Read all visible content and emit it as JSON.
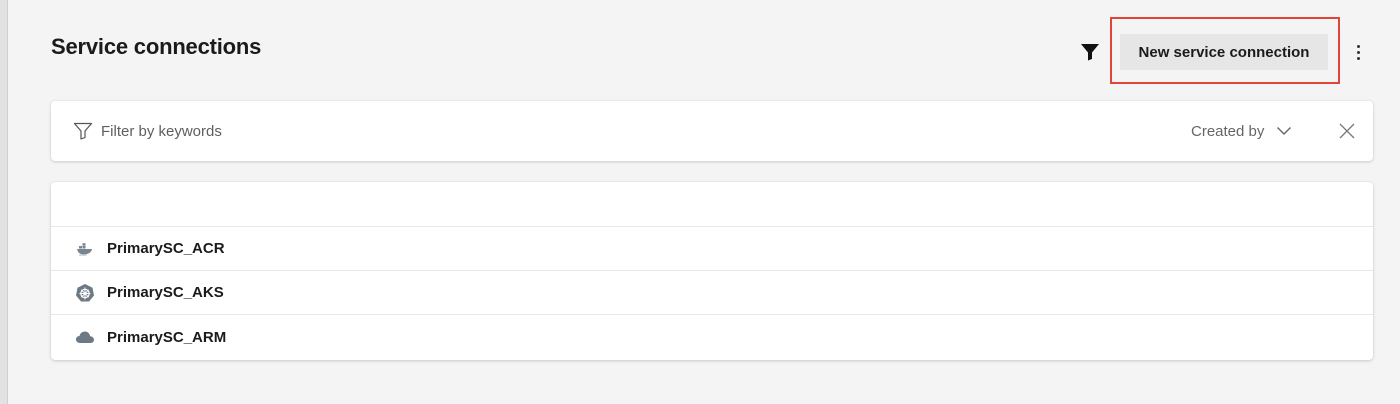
{
  "page": {
    "title": "Service connections"
  },
  "toolbar": {
    "new_button_label": "New service connection",
    "highlight_color": "#e0443a",
    "filter_toggle_icon": "funnel-icon",
    "more_icon": "more-vertical-icon"
  },
  "filter": {
    "placeholder": "Filter by keywords",
    "value": "",
    "created_by_label": "Created by",
    "dropdown_icon": "chevron-down-icon",
    "clear_icon": "close-icon"
  },
  "connections": [
    {
      "name": "PrimarySC_ACR",
      "icon": "docker-icon"
    },
    {
      "name": "PrimarySC_AKS",
      "icon": "kubernetes-icon"
    },
    {
      "name": "PrimarySC_ARM",
      "icon": "cloud-icon"
    }
  ]
}
